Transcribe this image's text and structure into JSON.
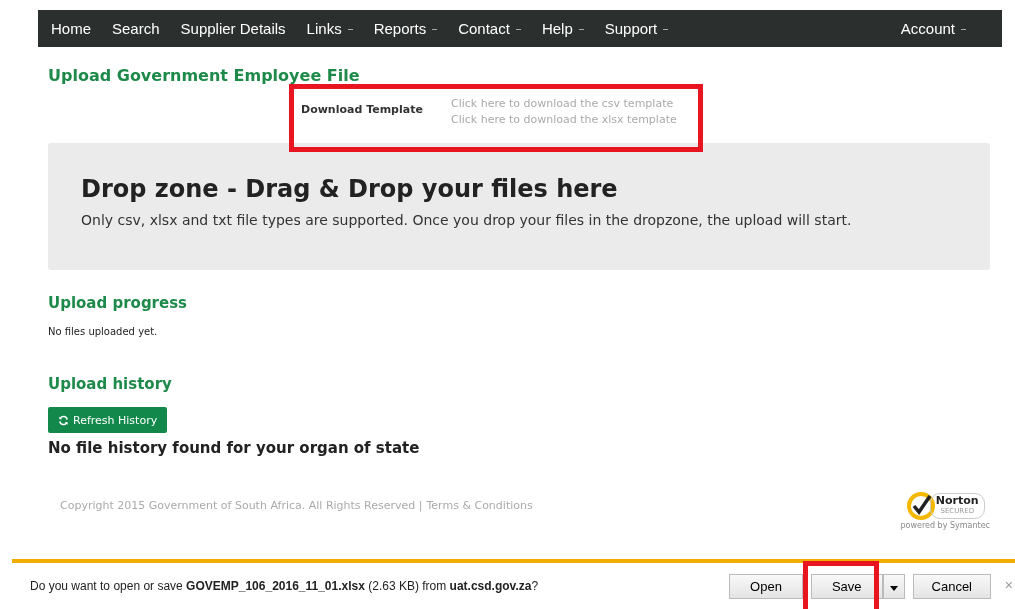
{
  "nav": {
    "items": [
      {
        "label": "Home",
        "dropdown": false
      },
      {
        "label": "Search",
        "dropdown": false
      },
      {
        "label": "Supplier Details",
        "dropdown": false
      },
      {
        "label": "Links",
        "dropdown": true
      },
      {
        "label": "Reports",
        "dropdown": true
      },
      {
        "label": "Contact",
        "dropdown": true
      },
      {
        "label": "Help",
        "dropdown": true
      },
      {
        "label": "Support",
        "dropdown": true
      }
    ],
    "account": {
      "label": "Account",
      "dropdown": true
    }
  },
  "page_title": "Upload Government Employee File",
  "download_template": {
    "label": "Download Template",
    "links": [
      "Click here to download the csv template",
      "Click here to download the xlsx template"
    ]
  },
  "dropzone": {
    "title": "Drop zone - Drag & Drop your files here",
    "text": "Only csv, xlsx and txt file types are supported. Once you drop your files in the dropzone, the upload will start."
  },
  "upload_progress": {
    "heading": "Upload progress",
    "text": "No files uploaded yet."
  },
  "upload_history": {
    "heading": "Upload history",
    "button": "Refresh History",
    "text": "No file history found for your organ of state"
  },
  "footer": {
    "copyright": "Copyright 2015 Government of South Africa. All Rights Reserved |",
    "link": "Terms & Conditions",
    "badge": {
      "name": "Norton",
      "sub": "SECURED",
      "powered": "powered by Symantec"
    }
  },
  "download_bar": {
    "message": "Do you want to open or save **GOVEMP_106_2016_11_01.xlsx** (2.63 KB) from **uat.csd.gov.za**?",
    "buttons": [
      "Open",
      "Save",
      "Cancel"
    ],
    "close": "×"
  }
}
